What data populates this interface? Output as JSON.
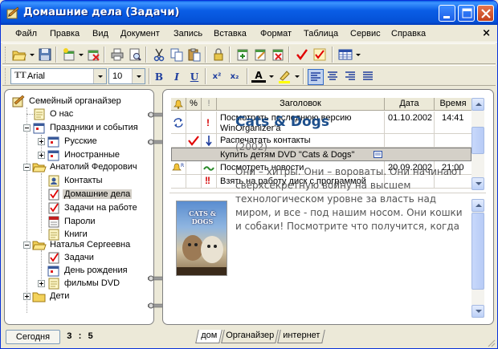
{
  "window": {
    "title": "Домашние дела (Задачи)"
  },
  "menu": {
    "items": [
      "Файл",
      "Правка",
      "Вид",
      "Документ",
      "Запись",
      "Вставка",
      "Формат",
      "Таблица",
      "Сервис",
      "Справка"
    ],
    "close_glyph": "×"
  },
  "format_toolbar": {
    "font_name": "Arial",
    "font_icon": "TT",
    "font_size": "10",
    "bold": "B",
    "italic": "I",
    "underline": "U",
    "superscript": "x²",
    "subscript": "x₂",
    "font_color_letter": "A",
    "text_color": "#000000",
    "highlight_color": "#ffff00"
  },
  "tree": {
    "items": [
      {
        "label": "Семейный органайзер",
        "icon": "organizer-icon"
      },
      {
        "label": "О нас",
        "icon": "note-icon"
      },
      {
        "label": "Праздники и события",
        "icon": "calendar-icon"
      },
      {
        "label": "Русские",
        "icon": "calendar-icon"
      },
      {
        "label": "Иностранные",
        "icon": "calendar-icon"
      },
      {
        "label": "Анатолий Федорович",
        "icon": "folder-open-icon"
      },
      {
        "label": "Контакты",
        "icon": "contacts-icon"
      },
      {
        "label": "Домашние дела",
        "icon": "tasks-icon"
      },
      {
        "label": "Задачи на работе",
        "icon": "tasks-icon"
      },
      {
        "label": "Пароли",
        "icon": "passwords-icon"
      },
      {
        "label": "Книги",
        "icon": "note-icon"
      },
      {
        "label": "Наталья Сергеевна",
        "icon": "folder-open-icon"
      },
      {
        "label": "Задачи",
        "icon": "tasks-icon"
      },
      {
        "label": "День рождения",
        "icon": "calendar-icon"
      },
      {
        "label": "фильмы DVD",
        "icon": "note-icon"
      },
      {
        "label": "Дети",
        "icon": "folder-icon"
      }
    ],
    "selected": "Домашние дела"
  },
  "grid": {
    "columns": {
      "reminder": "",
      "percent": "%",
      "priority": "!",
      "title": "Заголовок",
      "date": "Дата",
      "time": "Время"
    },
    "rows": [
      {
        "title": "Посмотреть последнюю версию WinOrganizer'a",
        "date": "01.10.2002",
        "time": "14:41",
        "status": "refresh-icon",
        "priority": "high-priority-icon"
      },
      {
        "title": "Распечатать контакты",
        "date": "",
        "time": "",
        "status": "done-check-icon",
        "priority": "low-priority-icon"
      },
      {
        "title": "Купить детям DVD \"Cats & Dogs\"",
        "date": "",
        "time": "",
        "status": "",
        "priority": "",
        "selected": true
      },
      {
        "title": "Посмотреть новости",
        "date": "20.09.2002",
        "time": "21:00",
        "status": "recurring-bell-icon",
        "priority": "normal-priority-icon"
      },
      {
        "title": "Взять на работу диск с программой",
        "date": "",
        "time": "",
        "status": "",
        "priority": "urgent-priority-icon"
      }
    ]
  },
  "preview": {
    "title": "Cats & Dogs",
    "year": "(2002)",
    "description": "Они – хитры. Они – вороваты. Они начинают сверхсекретную войну на высшем технологическом уровне за власть над миром, и все - под нашим носом. Они кошки и собаки! Посмотрите что получится, когда",
    "poster_caption": "CATS & DOGS"
  },
  "statusbar": {
    "today_button": "Сегодня",
    "count": "3 : 5",
    "tabs": [
      "дом",
      "Органайзер",
      "интернет"
    ],
    "active_tab": "дом"
  },
  "colors": {
    "titlebar": "#0a5ee6",
    "accent_text": "#1d4f8c",
    "priority_red": "#d40000",
    "check_red": "#e00000"
  }
}
